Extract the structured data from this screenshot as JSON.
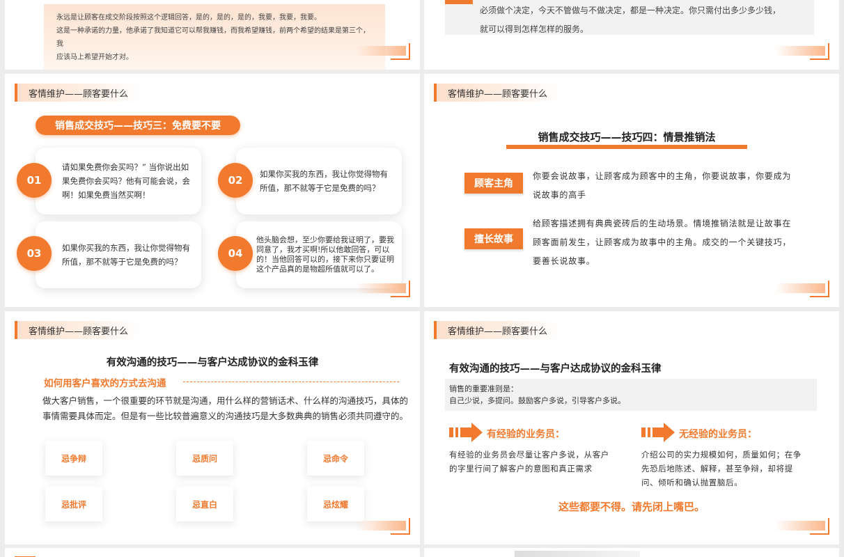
{
  "slideA": {
    "line1": "永远是让顾客在成交阶段按照这个逻辑回答，是的，是的，是的，我要，我要，我要。",
    "line2": "这是一种承诺的力量，他承诺了我知道它可以帮我赚钱，而我希望赚钱，前两个希望的结果是第三个，我",
    "line3": "应该马上希望开始才对。"
  },
  "slideB": {
    "line1": "必须做个决定，今天不管做与不做决定，都是一种决定。你只需付出多少多少钱，",
    "line2": "就可以得到怎样怎样的服务。"
  },
  "slideC": {
    "tag": "客情维护——顾客要什么",
    "pill": "销售成交技巧——技巧三：免费要不要",
    "cards": [
      {
        "num": "01",
        "text": "请如果免费你会买吗？” 当你说出如果免费你会买吗？他有可能会说，会啊！如果免费当然买啊！"
      },
      {
        "num": "02",
        "text": "如果你买我的东西，我让你觉得物有所值，那不就等于它是免费的吗？"
      },
      {
        "num": "03",
        "text": "如果你买我的东西，我让你觉得物有所值，那不就等于它是免费的吗？"
      },
      {
        "num": "04",
        "text": "他头脑会想，至少你要给我证明了，要我同意了，我才买啊!所以他敢回答，可以的！当他回答可以的，接下来你只要证明这个产品真的是物超所值就可以了。"
      }
    ]
  },
  "slideD": {
    "tag": "客情维护——顾客要什么",
    "title": "销售成交技巧——技巧四：情景推销法",
    "box1": "顾客主角",
    "text1": "你要会说故事，让顾客成为顾客中的主角，你要说故事，你要成为说故事的高手",
    "box2": "擅长故事",
    "text2": "给顾客描述拥有典典瓷砖后的生动场景。情境推销法就是让故事在顾客面前发生，让顾客成为故事中的主角。成交的一个关键技巧，要善长说故事。"
  },
  "slideE": {
    "tag": "客情维护——顾客要什么",
    "title": "有效沟通的技巧——与客户达成协议的金科玉律",
    "subtitle": "如何用客户喜欢的方式去沟通",
    "para": "做大客户销售，一个很重要的环节就是沟通，用什么样的营销话术、什么样的沟通技巧，具体的事情需要具体而定。但是有一些比较普遍意义的沟通技巧是大多数典典的销售必须共同遵守的。",
    "tabs": [
      "忌争辩",
      "忌质问",
      "忌命令",
      "忌批评",
      "忌直白",
      "忌炫耀"
    ]
  },
  "slideF": {
    "tag": "客情维护——顾客要什么",
    "title": "有效沟通的技巧——与客户达成协议的金科玉律",
    "rule_line1": "销售的重要准则是：",
    "rule_line2": "自己少说，多提问。鼓励客户多说，引导客户多说。",
    "left_head": "有经验的业务员：",
    "left_text": "有经验的业务员会尽量让客户多说，从客户的字里行间了解客户的意图和真正需求",
    "right_head": "无经验的业务员：",
    "right_text": "介绍公司的实力规模如何，质量如何；在争先恐后地陈述、解释，甚至争辩，却将提问、倾听和确认抛置脑后。",
    "ending": "这些都要不得。请先闭上嘴巴。"
  },
  "colors": {
    "accent": "#f27a2f",
    "page_bg": "#ececec"
  }
}
